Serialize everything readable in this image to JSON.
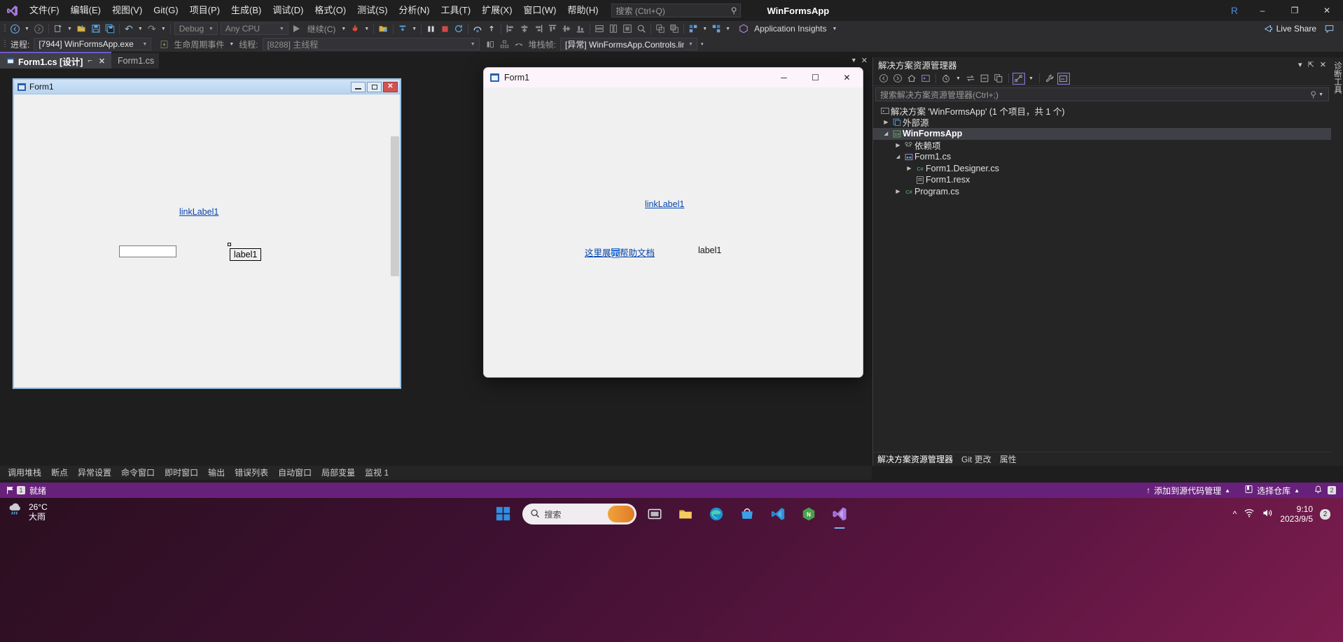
{
  "menubar": {
    "logo_icon": "visual-studio-logo",
    "items": [
      {
        "label": "文件(F)"
      },
      {
        "label": "编辑(E)"
      },
      {
        "label": "视图(V)"
      },
      {
        "label": "Git(G)"
      },
      {
        "label": "项目(P)"
      },
      {
        "label": "生成(B)"
      },
      {
        "label": "调试(D)"
      },
      {
        "label": "格式(O)"
      },
      {
        "label": "测试(S)"
      },
      {
        "label": "分析(N)"
      },
      {
        "label": "工具(T)"
      },
      {
        "label": "扩展(X)"
      },
      {
        "label": "窗口(W)"
      },
      {
        "label": "帮助(H)"
      }
    ],
    "search_placeholder": "搜索 (Ctrl+Q)",
    "app_title": "WinFormsApp",
    "account_badge": "R",
    "minimize": "–",
    "restore": "❐",
    "close": "✕"
  },
  "toolbar": {
    "nav_back": "◀",
    "nav_forward": "▶",
    "new_item": "new-file",
    "open_file": "open-folder",
    "save": "save",
    "save_all": "save-all",
    "undo": "↶",
    "redo": "↷",
    "config_combo": "Debug",
    "platform_combo": "Any CPU",
    "start_label": "继续(C)",
    "hot_reload": "hot-reload",
    "live_share": "Live Share",
    "app_insights": "Application Insights",
    "feedback_icon": "feedback"
  },
  "debugbar": {
    "process_label": "进程:",
    "process_value": "[7944] WinFormsApp.exe",
    "lifecycle_label": "生命周期事件",
    "thread_label": "线程:",
    "thread_value": "[8288] 主线程",
    "stackframe_label": "堆栈帧:",
    "stackframe_value": "[异常] WinFormsApp.Controls.linkLabe"
  },
  "tabs": {
    "items": [
      {
        "label": "Form1.cs [设计]",
        "active": true,
        "pin": "⌐",
        "close": "✕"
      },
      {
        "label": "Form1.cs",
        "active": false
      }
    ]
  },
  "designer_form": {
    "title": "Form1",
    "min_btn": "minimize",
    "max_btn": "maximize",
    "close_btn": "✕",
    "link_label": "linkLabel1",
    "label": "label1",
    "textbox_value": ""
  },
  "running_form": {
    "title": "Form1",
    "minimize": "─",
    "maximize": "☐",
    "close": "✕",
    "link_label": "linkLabel1",
    "help_link_prefix": "这里展",
    "help_link_selected": "示",
    "help_link_suffix": "帮助文档",
    "label": "label1"
  },
  "bottom_tabs": {
    "items": [
      {
        "label": "调用堆栈"
      },
      {
        "label": "断点"
      },
      {
        "label": "异常设置"
      },
      {
        "label": "命令窗口"
      },
      {
        "label": "即时窗口"
      },
      {
        "label": "输出"
      },
      {
        "label": "错误列表"
      },
      {
        "label": "自动窗口"
      },
      {
        "label": "局部变量"
      },
      {
        "label": "监视 1"
      }
    ]
  },
  "solution_explorer": {
    "title": "解决方案资源管理器",
    "header_actions": [
      "▾",
      "📌",
      "✕"
    ],
    "toolbar_icons": [
      "back-arrow-icon",
      "forward-arrow-icon",
      "home-icon",
      "solution-icon",
      "pending-changes-icon",
      "sync-icon",
      "collapse-all-icon",
      "show-all-files-icon",
      "properties-icon",
      "preview-selected-items-icon"
    ],
    "search_placeholder": "搜索解决方案资源管理器(Ctrl+;)",
    "tree": [
      {
        "label": "解决方案 'WinFormsApp' (1 个项目，共 1 个)",
        "indent": 0,
        "expander": "",
        "icon": "solution-icon",
        "selected": false
      },
      {
        "label": "外部源",
        "indent": 1,
        "expander": "▶",
        "icon": "external-sources-icon",
        "selected": false
      },
      {
        "label": "WinFormsApp",
        "indent": 1,
        "expander": "▲",
        "icon": "csharp-project-icon",
        "selected": true
      },
      {
        "label": "依赖项",
        "indent": 2,
        "expander": "▶",
        "icon": "dependencies-icon",
        "selected": false
      },
      {
        "label": "Form1.cs",
        "indent": 2,
        "expander": "▲",
        "icon": "form-icon",
        "selected": false
      },
      {
        "label": "Form1.Designer.cs",
        "indent": 3,
        "expander": "▶",
        "icon": "csharp-file-icon",
        "selected": false
      },
      {
        "label": "Form1.resx",
        "indent": 3,
        "expander": "",
        "icon": "resx-icon",
        "selected": false
      },
      {
        "label": "Program.cs",
        "indent": 2,
        "expander": "▶",
        "icon": "csharp-file-icon",
        "selected": false
      }
    ],
    "footer_tabs": [
      {
        "label": "解决方案资源管理器",
        "active": true
      },
      {
        "label": "Git 更改",
        "active": false
      },
      {
        "label": "属性",
        "active": false
      }
    ],
    "vertical_strip": "诊断工具"
  },
  "statusbar": {
    "state": "就绪",
    "error_count": "1",
    "source_control": "添加到源代码管理",
    "repo": "选择仓库",
    "notifications_count": "2",
    "bell_icon": "bell-icon"
  },
  "taskbar": {
    "weather_temp": "26°C",
    "weather_desc": "大雨",
    "weather_icon": "rain-icon",
    "start_icon": "windows-start-icon",
    "search_placeholder": "搜索",
    "pinned": [
      {
        "name": "task-view-icon"
      },
      {
        "name": "file-explorer-icon"
      },
      {
        "name": "edge-icon"
      },
      {
        "name": "store-icon"
      },
      {
        "name": "vscode-icon"
      },
      {
        "name": "nodejs-icon"
      },
      {
        "name": "visual-studio-icon"
      }
    ],
    "clock_time": "9:10",
    "clock_date": "2023/9/5",
    "tray_badge": "2"
  },
  "colors": {
    "accent_purple": "#68217a",
    "tab_accent": "#6a5acd",
    "link_blue": "#0645ad",
    "selection_blue": "#2b6fd4"
  }
}
